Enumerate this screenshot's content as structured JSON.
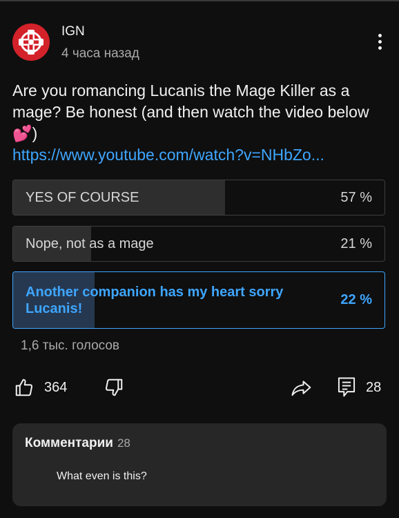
{
  "channel": {
    "name": "IGN",
    "time_ago": "4 часа назад",
    "avatar_icon": "ign-logo-icon",
    "brand_color": "#d3222a"
  },
  "post": {
    "text": "Are you romancing Lucanis the Mage Killer as a mage? Be honest (and then watch the video below 💕)",
    "link": "https://www.youtube.com/watch?v=NHbZo..."
  },
  "poll": {
    "options": [
      {
        "label": "YES OF COURSE",
        "percent_text": "57 %",
        "percent": 57,
        "selected": false
      },
      {
        "label": "Nope, not as a mage",
        "percent_text": "21 %",
        "percent": 21,
        "selected": false
      },
      {
        "label": "Another companion has my heart sorry Lucanis!",
        "percent_text": "22 %",
        "percent": 22,
        "selected": true
      }
    ],
    "votes": "1,6 тыс. голосов",
    "accent_color": "#3ea6ff"
  },
  "actions": {
    "like_count": "364",
    "comment_count": "28",
    "icons": [
      "thumbs-up-icon",
      "thumbs-down-icon",
      "share-icon",
      "comment-icon"
    ]
  },
  "comments": {
    "title": "Комментарии",
    "count": "28",
    "preview_text": "What even is this?"
  }
}
